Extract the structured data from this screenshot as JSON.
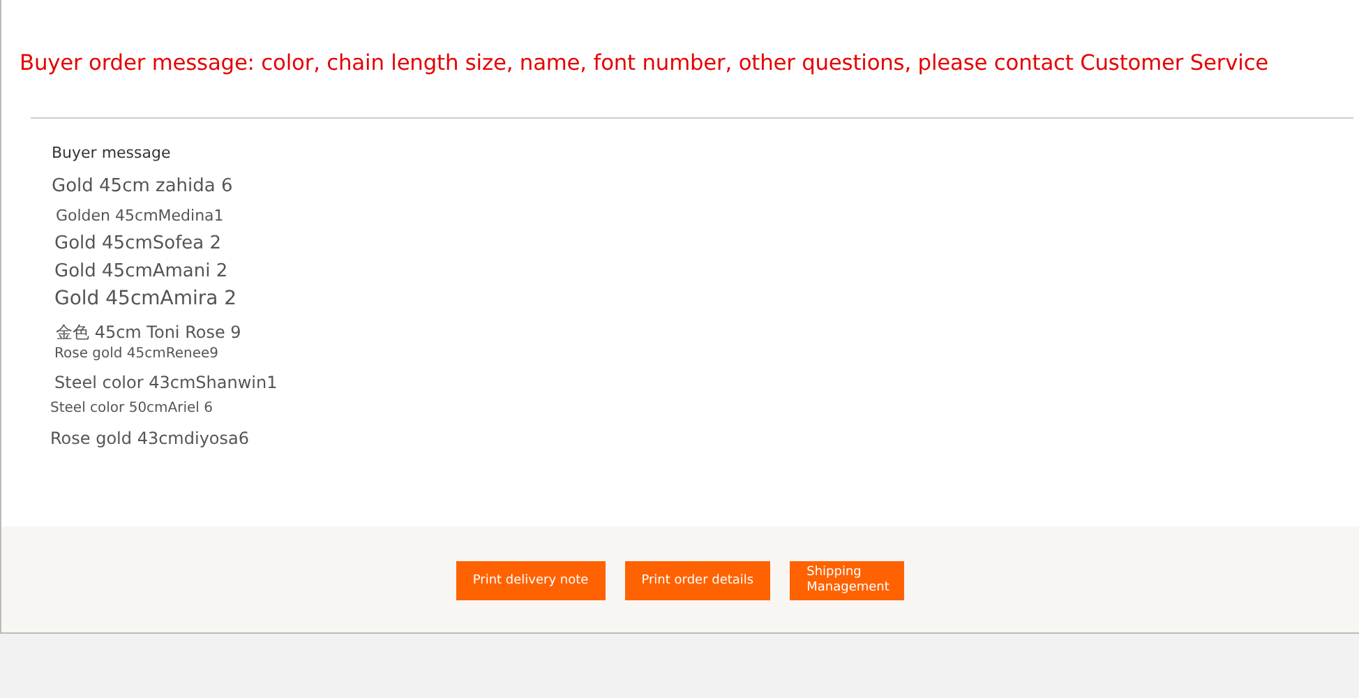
{
  "notice": "Buyer order message: color, chain length size, name, font number, other questions, please contact Customer Service",
  "message_heading": "Buyer message",
  "messages": [
    "Gold 45cm zahida 6",
    "Golden 45cmMedina1",
    "Gold 45cmSofea 2",
    "Gold 45cmAmani 2",
    "Gold 45cmAmira 2",
    "金色 45cm Toni Rose 9",
    "Rose gold 45cmRenee9",
    "Steel color 43cmShanwin1",
    "Steel color 50cmAriel 6",
    "Rose gold 43cmdiyosa6"
  ],
  "buttons": [
    "Print delivery note",
    "Print order details",
    "Shipping Management"
  ]
}
